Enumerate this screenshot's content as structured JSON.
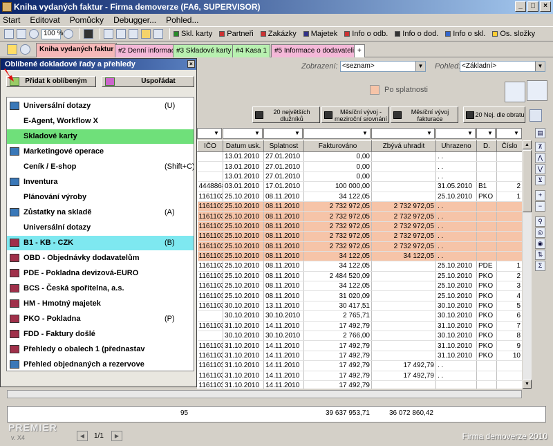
{
  "window": {
    "title": "Kniha vydaných faktur - Firma demoverze (FA6, SUPERVISOR)"
  },
  "menu": [
    "Start",
    "Editovat",
    "Pomůcky",
    "Debugger...",
    "Pohled..."
  ],
  "toolbar": {
    "zoom": "100 %",
    "links": [
      "Skl. karty",
      "Partneři",
      "Zakázky",
      "Majetek",
      "Info o odb.",
      "Info o dod.",
      "Info o skl.",
      "Os. složky"
    ]
  },
  "tabs": [
    "Kniha vydaných faktur",
    "#2 Denní informace",
    "#3 Skladové karty",
    "#4 Kasa 1",
    "#5 Informace o dodavateli",
    "+"
  ],
  "filters": {
    "zobrazeni_label": "Zobrazení:",
    "zobrazeni_value": "<seznam>",
    "pohled_label": "Pohled:",
    "pohled_value": "<Základní>",
    "legend": "Po splatnosti"
  },
  "report_buttons": [
    "20 největších dlužníků",
    "Měsíční vývoj - meziroční srovnání",
    "Měsíční vývoj fakturace",
    "20 Nej. dle obratu"
  ],
  "table": {
    "columns": [
      "IČO",
      "Datum usk.",
      "Splatnost",
      "Fakturováno",
      "Zbývá uhradit",
      "Uhrazeno",
      "D.",
      "Číslo"
    ],
    "rows": [
      [
        "",
        "13.01.2010",
        "27.01.2010",
        "0,00",
        "",
        ". .",
        "",
        ""
      ],
      [
        "",
        "13.01.2010",
        "27.01.2010",
        "0,00",
        "",
        ". .",
        "",
        ""
      ],
      [
        "",
        "13.01.2010",
        "27.01.2010",
        "0,00",
        "",
        ". .",
        "",
        ""
      ],
      [
        "4448868",
        "03.01.2010",
        "17.01.2010",
        "100 000,00",
        "",
        "31.05.2010",
        "B1",
        "2"
      ],
      [
        "1161103",
        "25.10.2010",
        "08.11.2010",
        "34 122,05",
        "",
        "25.10.2010",
        "PKO",
        "1"
      ],
      [
        "1161103",
        "25.10.2010",
        "08.11.2010",
        "2 732 972,05",
        "2 732 972,05",
        ". .",
        "",
        ""
      ],
      [
        "1161103",
        "25.10.2010",
        "08.11.2010",
        "2 732 972,05",
        "2 732 972,05",
        ". .",
        "",
        ""
      ],
      [
        "1161103",
        "25.10.2010",
        "08.11.2010",
        "2 732 972,05",
        "2 732 972,05",
        ". .",
        "",
        ""
      ],
      [
        "1161103",
        "25.10.2010",
        "08.11.2010",
        "2 732 972,05",
        "2 732 972,05",
        ". .",
        "",
        ""
      ],
      [
        "1161103",
        "25.10.2010",
        "08.11.2010",
        "2 732 972,05",
        "2 732 972,05",
        ". .",
        "",
        ""
      ],
      [
        "1161103",
        "25.10.2010",
        "08.11.2010",
        "34 122,05",
        "34 122,05",
        ". .",
        "",
        ""
      ],
      [
        "1161103",
        "25.10.2010",
        "08.11.2010",
        "34 122,05",
        "",
        "25.10.2010",
        "PDE",
        "1"
      ],
      [
        "1161103",
        "25.10.2010",
        "08.11.2010",
        "2 484 520,09",
        "",
        "25.10.2010",
        "PKO",
        "2"
      ],
      [
        "1161103",
        "25.10.2010",
        "08.11.2010",
        "34 122,05",
        "",
        "25.10.2010",
        "PKO",
        "3"
      ],
      [
        "1161103",
        "25.10.2010",
        "08.11.2010",
        "31 020,09",
        "",
        "25.10.2010",
        "PKO",
        "4"
      ],
      [
        "1161103",
        "30.10.2010",
        "13.11.2010",
        "30 417,51",
        "",
        "30.10.2010",
        "PKO",
        "5"
      ],
      [
        "",
        "30.10.2010",
        "30.10.2010",
        "2 765,71",
        "",
        "30.10.2010",
        "PKO",
        "6"
      ],
      [
        "1161103",
        "31.10.2010",
        "14.11.2010",
        "17 492,79",
        "",
        "31.10.2010",
        "PKO",
        "7"
      ],
      [
        "",
        "30.10.2010",
        "30.10.2010",
        "2 766,00",
        "",
        "30.10.2010",
        "PKO",
        "8"
      ],
      [
        "1161103",
        "31.10.2010",
        "14.11.2010",
        "17 492,79",
        "",
        "31.10.2010",
        "PKO",
        "9"
      ],
      [
        "1161103",
        "31.10.2010",
        "14.11.2010",
        "17 492,79",
        "",
        "31.10.2010",
        "PKO",
        "10"
      ],
      [
        "1161103",
        "31.10.2010",
        "14.11.2010",
        "17 492,79",
        "17 492,79",
        ". .",
        "",
        ""
      ],
      [
        "1161103",
        "31.10.2010",
        "14.11.2010",
        "17 492,79",
        "17 492,79",
        ". .",
        "",
        ""
      ],
      [
        "1161103",
        "31.10.2010",
        "14.11.2010",
        "17 492,79",
        "",
        "",
        "",
        ""
      ]
    ],
    "highlighted_rows": [
      5,
      6,
      7,
      8,
      9,
      10
    ]
  },
  "footer": {
    "count": "95",
    "fakturovano": "39 637 953,71",
    "zbyva": "36 072 860,42"
  },
  "branding": {
    "logo": "PREMIER",
    "version": "v. X4",
    "company": "Firma demoverze 2010"
  },
  "popup": {
    "title": "Oblíbené dokladové řady a přehledy",
    "add_button": "Přidat k oblíbeným",
    "arrange_button": "Uspořádat",
    "pager": "1/1",
    "items": [
      {
        "label": "Universální dotazy",
        "shortcut": "(U)",
        "icon": "book-icon-blue"
      },
      {
        "label": "E-Agent, Workflow X",
        "shortcut": "",
        "icon": ""
      },
      {
        "label": "Skladové karty",
        "shortcut": "",
        "icon": ""
      },
      {
        "label": "Marketingové operace",
        "shortcut": "",
        "icon": "book-icon-blue"
      },
      {
        "label": "Ceník / E-shop",
        "shortcut": "(Shift+C)",
        "icon": ""
      },
      {
        "label": "Inventura",
        "shortcut": "",
        "icon": "book-icon-blue"
      },
      {
        "label": "Plánování výroby",
        "shortcut": "",
        "icon": ""
      },
      {
        "label": "Zůstatky na skladě",
        "shortcut": "(A)",
        "icon": "book-icon-blue"
      },
      {
        "label": "Universální dotazy",
        "shortcut": "",
        "icon": ""
      },
      {
        "label": "B1  - KB  - CZK",
        "shortcut": "(B)",
        "icon": "book-icon-red"
      },
      {
        "label": "OBD - Objednávky dodavatelům",
        "shortcut": "",
        "icon": "book-icon-red"
      },
      {
        "label": "PDE - Pokladna devizová-EURO",
        "shortcut": "",
        "icon": "book-icon-red"
      },
      {
        "label": "BCS - Česká spořitelna, a.s.",
        "shortcut": "",
        "icon": "book-icon-red"
      },
      {
        "label": "HM  - Hmotný majetek",
        "shortcut": "",
        "icon": "book-icon-red"
      },
      {
        "label": "PKO - Pokladna",
        "shortcut": "(P)",
        "icon": "book-icon-red"
      },
      {
        "label": "FDD - Faktury došlé",
        "shortcut": "",
        "icon": "book-icon-red"
      },
      {
        "label": "Přehledy o obalech 1 (přednastav",
        "shortcut": "",
        "icon": "book-icon-red"
      },
      {
        "label": "Přehled objednaných a rezervove",
        "shortcut": "",
        "icon": "book-icon-blue"
      }
    ]
  },
  "colors": {
    "overdue": "#f6c4a8",
    "selected_green": "#6fe07a",
    "selected_cyan": "#7ee8f0"
  }
}
